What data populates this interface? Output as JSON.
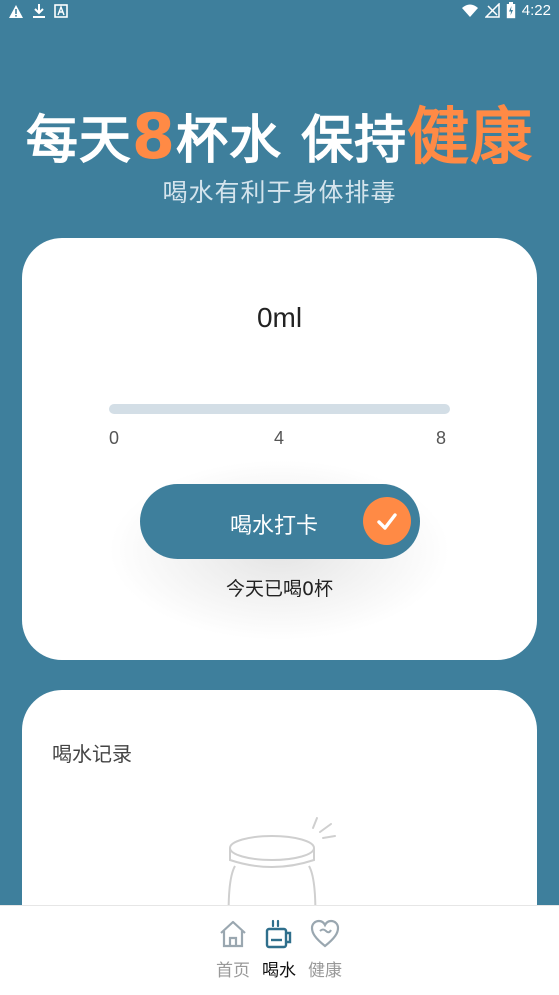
{
  "status_bar": {
    "time": "4:22"
  },
  "header": {
    "title_part1": "每天",
    "title_number": "8",
    "title_part2": "杯水 保持",
    "title_highlight": "健康",
    "subtitle": "喝水有利于身体排毒"
  },
  "tracker": {
    "amount": "0ml",
    "progress_fraction": 0,
    "scale_labels": [
      "0",
      "4",
      "8"
    ],
    "checkin_label": "喝水打卡",
    "today_count": "今天已喝0杯"
  },
  "record": {
    "title": "喝水记录"
  },
  "nav": {
    "items": [
      {
        "label": "首页",
        "active": false
      },
      {
        "label": "喝水",
        "active": true
      },
      {
        "label": "健康",
        "active": false
      }
    ]
  },
  "colors": {
    "primary": "#3e7f9c",
    "accent": "#ff8a45",
    "track": "#d3dee6"
  }
}
